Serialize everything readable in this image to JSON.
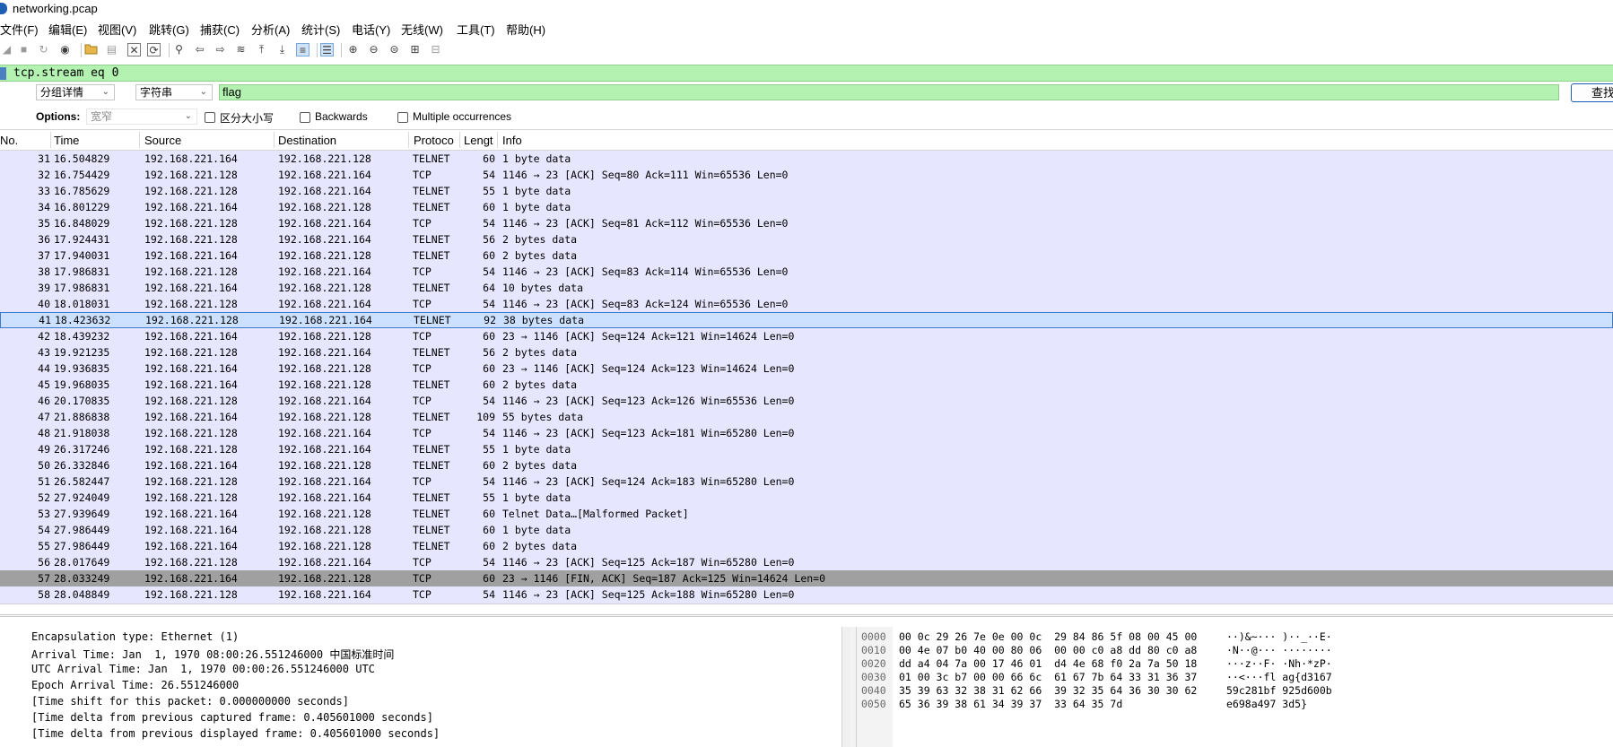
{
  "window": {
    "title": "networking.pcap"
  },
  "menu": [
    "文件(F)",
    "编辑(E)",
    "视图(V)",
    "跳转(G)",
    "捕获(C)",
    "分析(A)",
    "统计(S)",
    "电话(Y)",
    "无线(W)",
    "工具(T)",
    "帮助(H)"
  ],
  "toolbar": {
    "icons": [
      "start-capture",
      "stop-capture",
      "restart-capture",
      "capture-options",
      "open-file",
      "save-file",
      "close-file",
      "reload-file",
      "find-packet",
      "go-back",
      "go-forward",
      "go-to-packet",
      "go-first",
      "go-last",
      "auto-scroll",
      "colorize",
      "zoom-in",
      "zoom-out",
      "normal-size",
      "resize-columns",
      "layout"
    ]
  },
  "filter": {
    "value": "tcp.stream eq 0"
  },
  "find": {
    "search_in": "分组详情",
    "search_type": "字符串",
    "value": "flag",
    "button_label": "查找",
    "options_label": "Options:",
    "charset": "宽窄",
    "case_sensitive": "区分大小写",
    "backwards": "Backwards",
    "multiple": "Multiple occurrences"
  },
  "packet_list": {
    "columns": [
      "No.",
      "Time",
      "Source",
      "Destination",
      "Protoco",
      "Lengt",
      "Info"
    ],
    "rows": [
      {
        "no": "31",
        "time": "16.504829",
        "src": "192.168.221.164",
        "dst": "192.168.221.128",
        "proto": "TELNET",
        "len": "60",
        "info": "1 byte data"
      },
      {
        "no": "32",
        "time": "16.754429",
        "src": "192.168.221.128",
        "dst": "192.168.221.164",
        "proto": "TCP",
        "len": "54",
        "info": "1146 → 23 [ACK] Seq=80 Ack=111 Win=65536 Len=0"
      },
      {
        "no": "33",
        "time": "16.785629",
        "src": "192.168.221.128",
        "dst": "192.168.221.164",
        "proto": "TELNET",
        "len": "55",
        "info": "1 byte data"
      },
      {
        "no": "34",
        "time": "16.801229",
        "src": "192.168.221.164",
        "dst": "192.168.221.128",
        "proto": "TELNET",
        "len": "60",
        "info": "1 byte data"
      },
      {
        "no": "35",
        "time": "16.848029",
        "src": "192.168.221.128",
        "dst": "192.168.221.164",
        "proto": "TCP",
        "len": "54",
        "info": "1146 → 23 [ACK] Seq=81 Ack=112 Win=65536 Len=0"
      },
      {
        "no": "36",
        "time": "17.924431",
        "src": "192.168.221.128",
        "dst": "192.168.221.164",
        "proto": "TELNET",
        "len": "56",
        "info": "2 bytes data"
      },
      {
        "no": "37",
        "time": "17.940031",
        "src": "192.168.221.164",
        "dst": "192.168.221.128",
        "proto": "TELNET",
        "len": "60",
        "info": "2 bytes data"
      },
      {
        "no": "38",
        "time": "17.986831",
        "src": "192.168.221.128",
        "dst": "192.168.221.164",
        "proto": "TCP",
        "len": "54",
        "info": "1146 → 23 [ACK] Seq=83 Ack=114 Win=65536 Len=0"
      },
      {
        "no": "39",
        "time": "17.986831",
        "src": "192.168.221.164",
        "dst": "192.168.221.128",
        "proto": "TELNET",
        "len": "64",
        "info": "10 bytes data"
      },
      {
        "no": "40",
        "time": "18.018031",
        "src": "192.168.221.128",
        "dst": "192.168.221.164",
        "proto": "TCP",
        "len": "54",
        "info": "1146 → 23 [ACK] Seq=83 Ack=124 Win=65536 Len=0"
      },
      {
        "no": "41",
        "time": "18.423632",
        "src": "192.168.221.128",
        "dst": "192.168.221.164",
        "proto": "TELNET",
        "len": "92",
        "info": "38 bytes data",
        "state": "selected"
      },
      {
        "no": "42",
        "time": "18.439232",
        "src": "192.168.221.164",
        "dst": "192.168.221.128",
        "proto": "TCP",
        "len": "60",
        "info": "23 → 1146 [ACK] Seq=124 Ack=121 Win=14624 Len=0"
      },
      {
        "no": "43",
        "time": "19.921235",
        "src": "192.168.221.128",
        "dst": "192.168.221.164",
        "proto": "TELNET",
        "len": "56",
        "info": "2 bytes data"
      },
      {
        "no": "44",
        "time": "19.936835",
        "src": "192.168.221.164",
        "dst": "192.168.221.128",
        "proto": "TCP",
        "len": "60",
        "info": "23 → 1146 [ACK] Seq=124 Ack=123 Win=14624 Len=0"
      },
      {
        "no": "45",
        "time": "19.968035",
        "src": "192.168.221.164",
        "dst": "192.168.221.128",
        "proto": "TELNET",
        "len": "60",
        "info": "2 bytes data"
      },
      {
        "no": "46",
        "time": "20.170835",
        "src": "192.168.221.128",
        "dst": "192.168.221.164",
        "proto": "TCP",
        "len": "54",
        "info": "1146 → 23 [ACK] Seq=123 Ack=126 Win=65536 Len=0"
      },
      {
        "no": "47",
        "time": "21.886838",
        "src": "192.168.221.164",
        "dst": "192.168.221.128",
        "proto": "TELNET",
        "len": "109",
        "info": "55 bytes data"
      },
      {
        "no": "48",
        "time": "21.918038",
        "src": "192.168.221.128",
        "dst": "192.168.221.164",
        "proto": "TCP",
        "len": "54",
        "info": "1146 → 23 [ACK] Seq=123 Ack=181 Win=65280 Len=0"
      },
      {
        "no": "49",
        "time": "26.317246",
        "src": "192.168.221.128",
        "dst": "192.168.221.164",
        "proto": "TELNET",
        "len": "55",
        "info": "1 byte data"
      },
      {
        "no": "50",
        "time": "26.332846",
        "src": "192.168.221.164",
        "dst": "192.168.221.128",
        "proto": "TELNET",
        "len": "60",
        "info": "2 bytes data"
      },
      {
        "no": "51",
        "time": "26.582447",
        "src": "192.168.221.128",
        "dst": "192.168.221.164",
        "proto": "TCP",
        "len": "54",
        "info": "1146 → 23 [ACK] Seq=124 Ack=183 Win=65280 Len=0"
      },
      {
        "no": "52",
        "time": "27.924049",
        "src": "192.168.221.128",
        "dst": "192.168.221.164",
        "proto": "TELNET",
        "len": "55",
        "info": "1 byte data"
      },
      {
        "no": "53",
        "time": "27.939649",
        "src": "192.168.221.164",
        "dst": "192.168.221.128",
        "proto": "TELNET",
        "len": "60",
        "info": "Telnet Data…[Malformed Packet]"
      },
      {
        "no": "54",
        "time": "27.986449",
        "src": "192.168.221.164",
        "dst": "192.168.221.128",
        "proto": "TELNET",
        "len": "60",
        "info": "1 byte data"
      },
      {
        "no": "55",
        "time": "27.986449",
        "src": "192.168.221.164",
        "dst": "192.168.221.128",
        "proto": "TELNET",
        "len": "60",
        "info": "2 bytes data"
      },
      {
        "no": "56",
        "time": "28.017649",
        "src": "192.168.221.128",
        "dst": "192.168.221.164",
        "proto": "TCP",
        "len": "54",
        "info": "1146 → 23 [ACK] Seq=125 Ack=187 Win=65280 Len=0"
      },
      {
        "no": "57",
        "time": "28.033249",
        "src": "192.168.221.164",
        "dst": "192.168.221.128",
        "proto": "TCP",
        "len": "60",
        "info": "23 → 1146 [FIN, ACK] Seq=187 Ack=125 Win=14624 Len=0",
        "state": "dark"
      },
      {
        "no": "58",
        "time": "28.048849",
        "src": "192.168.221.128",
        "dst": "192.168.221.164",
        "proto": "TCP",
        "len": "54",
        "info": "1146 → 23 [ACK] Seq=125 Ack=188 Win=65280 Len=0"
      }
    ]
  },
  "details": [
    "Encapsulation type: Ethernet (1)",
    "Arrival Time: Jan  1, 1970 08:00:26.551246000 中国标准时间",
    "UTC Arrival Time: Jan  1, 1970 00:00:26.551246000 UTC",
    "Epoch Arrival Time: 26.551246000",
    "[Time shift for this packet: 0.000000000 seconds]",
    "[Time delta from previous captured frame: 0.405601000 seconds]",
    "[Time delta from previous displayed frame: 0.405601000 seconds]"
  ],
  "bytes": {
    "offsets": [
      "0000",
      "0010",
      "0020",
      "0030",
      "0040",
      "0050"
    ],
    "hex": [
      "00 0c 29 26 7e 0e 00 0c  29 84 86 5f 08 00 45 00",
      "00 4e 07 b0 40 00 80 06  00 00 c0 a8 dd 80 c0 a8",
      "dd a4 04 7a 00 17 46 01  d4 4e 68 f0 2a 7a 50 18",
      "01 00 3c b7 00 00 66 6c  61 67 7b 64 33 31 36 37",
      "35 39 63 32 38 31 62 66  39 32 35 64 36 30 30 62",
      "65 36 39 38 61 34 39 37  33 64 35 7d"
    ],
    "ascii": [
      "··)&~··· )··_··E·",
      "·N··@··· ········",
      "···z··F· ·Nh·*zP·",
      "··<···fl ag{d3167",
      "59c281bf 925d600b",
      "e698a497 3d5}"
    ]
  }
}
